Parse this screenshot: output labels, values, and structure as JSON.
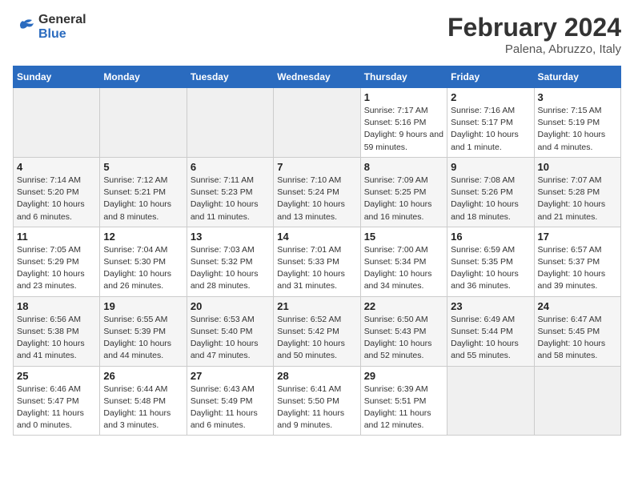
{
  "logo": {
    "line1": "General",
    "line2": "Blue"
  },
  "title": "February 2024",
  "subtitle": "Palena, Abruzzo, Italy",
  "weekdays": [
    "Sunday",
    "Monday",
    "Tuesday",
    "Wednesday",
    "Thursday",
    "Friday",
    "Saturday"
  ],
  "weeks": [
    [
      {
        "day": "",
        "info": ""
      },
      {
        "day": "",
        "info": ""
      },
      {
        "day": "",
        "info": ""
      },
      {
        "day": "",
        "info": ""
      },
      {
        "day": "1",
        "info": "Sunrise: 7:17 AM\nSunset: 5:16 PM\nDaylight: 9 hours and 59 minutes."
      },
      {
        "day": "2",
        "info": "Sunrise: 7:16 AM\nSunset: 5:17 PM\nDaylight: 10 hours and 1 minute."
      },
      {
        "day": "3",
        "info": "Sunrise: 7:15 AM\nSunset: 5:19 PM\nDaylight: 10 hours and 4 minutes."
      }
    ],
    [
      {
        "day": "4",
        "info": "Sunrise: 7:14 AM\nSunset: 5:20 PM\nDaylight: 10 hours and 6 minutes."
      },
      {
        "day": "5",
        "info": "Sunrise: 7:12 AM\nSunset: 5:21 PM\nDaylight: 10 hours and 8 minutes."
      },
      {
        "day": "6",
        "info": "Sunrise: 7:11 AM\nSunset: 5:23 PM\nDaylight: 10 hours and 11 minutes."
      },
      {
        "day": "7",
        "info": "Sunrise: 7:10 AM\nSunset: 5:24 PM\nDaylight: 10 hours and 13 minutes."
      },
      {
        "day": "8",
        "info": "Sunrise: 7:09 AM\nSunset: 5:25 PM\nDaylight: 10 hours and 16 minutes."
      },
      {
        "day": "9",
        "info": "Sunrise: 7:08 AM\nSunset: 5:26 PM\nDaylight: 10 hours and 18 minutes."
      },
      {
        "day": "10",
        "info": "Sunrise: 7:07 AM\nSunset: 5:28 PM\nDaylight: 10 hours and 21 minutes."
      }
    ],
    [
      {
        "day": "11",
        "info": "Sunrise: 7:05 AM\nSunset: 5:29 PM\nDaylight: 10 hours and 23 minutes."
      },
      {
        "day": "12",
        "info": "Sunrise: 7:04 AM\nSunset: 5:30 PM\nDaylight: 10 hours and 26 minutes."
      },
      {
        "day": "13",
        "info": "Sunrise: 7:03 AM\nSunset: 5:32 PM\nDaylight: 10 hours and 28 minutes."
      },
      {
        "day": "14",
        "info": "Sunrise: 7:01 AM\nSunset: 5:33 PM\nDaylight: 10 hours and 31 minutes."
      },
      {
        "day": "15",
        "info": "Sunrise: 7:00 AM\nSunset: 5:34 PM\nDaylight: 10 hours and 34 minutes."
      },
      {
        "day": "16",
        "info": "Sunrise: 6:59 AM\nSunset: 5:35 PM\nDaylight: 10 hours and 36 minutes."
      },
      {
        "day": "17",
        "info": "Sunrise: 6:57 AM\nSunset: 5:37 PM\nDaylight: 10 hours and 39 minutes."
      }
    ],
    [
      {
        "day": "18",
        "info": "Sunrise: 6:56 AM\nSunset: 5:38 PM\nDaylight: 10 hours and 41 minutes."
      },
      {
        "day": "19",
        "info": "Sunrise: 6:55 AM\nSunset: 5:39 PM\nDaylight: 10 hours and 44 minutes."
      },
      {
        "day": "20",
        "info": "Sunrise: 6:53 AM\nSunset: 5:40 PM\nDaylight: 10 hours and 47 minutes."
      },
      {
        "day": "21",
        "info": "Sunrise: 6:52 AM\nSunset: 5:42 PM\nDaylight: 10 hours and 50 minutes."
      },
      {
        "day": "22",
        "info": "Sunrise: 6:50 AM\nSunset: 5:43 PM\nDaylight: 10 hours and 52 minutes."
      },
      {
        "day": "23",
        "info": "Sunrise: 6:49 AM\nSunset: 5:44 PM\nDaylight: 10 hours and 55 minutes."
      },
      {
        "day": "24",
        "info": "Sunrise: 6:47 AM\nSunset: 5:45 PM\nDaylight: 10 hours and 58 minutes."
      }
    ],
    [
      {
        "day": "25",
        "info": "Sunrise: 6:46 AM\nSunset: 5:47 PM\nDaylight: 11 hours and 0 minutes."
      },
      {
        "day": "26",
        "info": "Sunrise: 6:44 AM\nSunset: 5:48 PM\nDaylight: 11 hours and 3 minutes."
      },
      {
        "day": "27",
        "info": "Sunrise: 6:43 AM\nSunset: 5:49 PM\nDaylight: 11 hours and 6 minutes."
      },
      {
        "day": "28",
        "info": "Sunrise: 6:41 AM\nSunset: 5:50 PM\nDaylight: 11 hours and 9 minutes."
      },
      {
        "day": "29",
        "info": "Sunrise: 6:39 AM\nSunset: 5:51 PM\nDaylight: 11 hours and 12 minutes."
      },
      {
        "day": "",
        "info": ""
      },
      {
        "day": "",
        "info": ""
      }
    ]
  ]
}
